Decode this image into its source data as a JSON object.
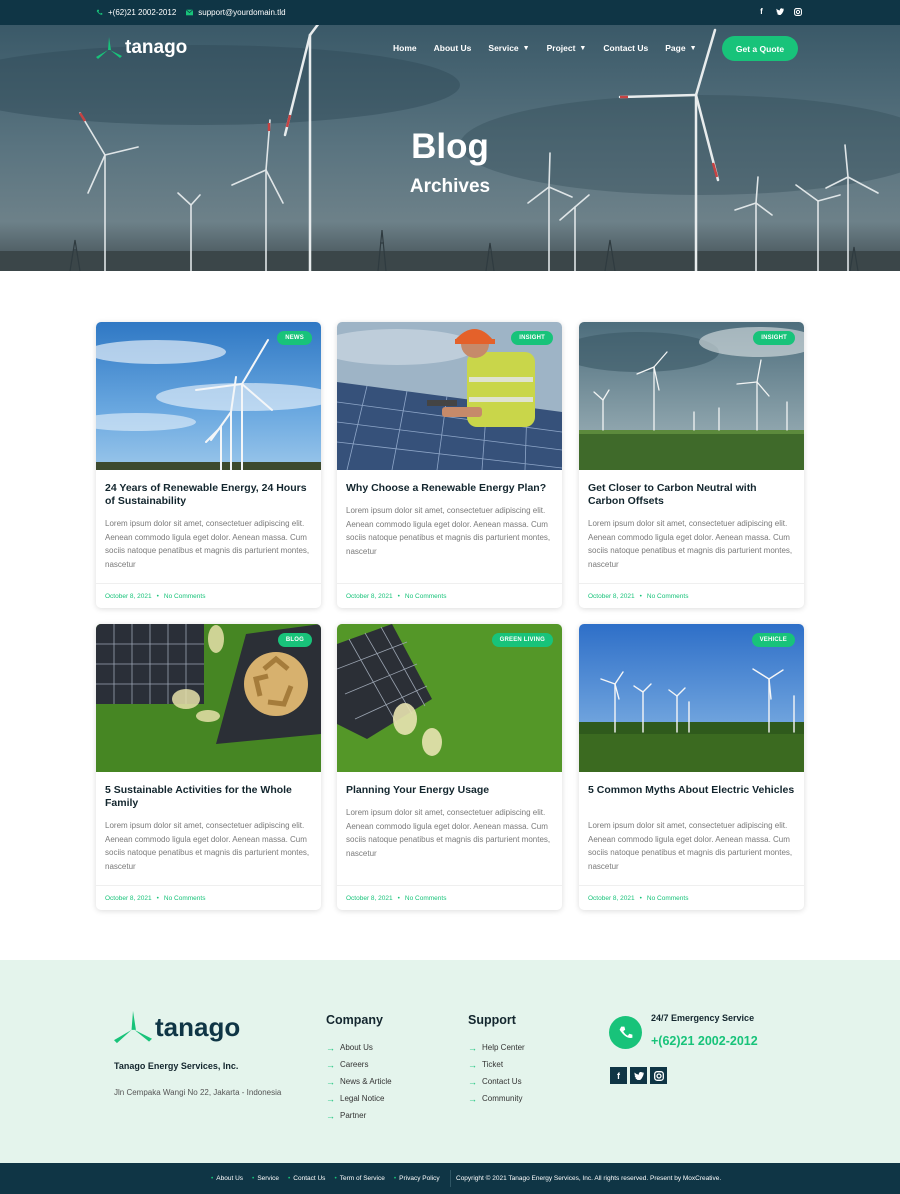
{
  "topbar": {
    "phone": "+(62)21 2002-2012",
    "email": "support@yourdomain.tld",
    "social": [
      "facebook-icon",
      "twitter-icon",
      "instagram-icon"
    ]
  },
  "nav": {
    "logo": "tanago",
    "menu": [
      {
        "label": "Home",
        "dropdown": false
      },
      {
        "label": "About Us",
        "dropdown": false
      },
      {
        "label": "Service",
        "dropdown": true
      },
      {
        "label": "Project",
        "dropdown": true
      },
      {
        "label": "Contact Us",
        "dropdown": false
      },
      {
        "label": "Page",
        "dropdown": true
      }
    ],
    "cta": "Get a Quote"
  },
  "hero": {
    "title": "Blog",
    "subtitle": "Archives"
  },
  "posts": [
    {
      "badge": "News",
      "title": "24 Years of Renewable Energy, 24 Hours of Sustainability",
      "excerpt": "Lorem ipsum dolor sit amet, consectetuer adipiscing elit. Aenean commodo ligula eget dolor. Aenean massa. Cum sociis natoque penatibus et magnis dis parturient montes, nascetur",
      "date": "October 8, 2021",
      "comments": "No Comments"
    },
    {
      "badge": "Insight",
      "title": "Why Choose a Renewable Energy Plan?",
      "excerpt": "Lorem ipsum dolor sit amet, consectetuer adipiscing elit. Aenean commodo ligula eget dolor. Aenean massa. Cum sociis natoque penatibus et magnis dis parturient montes, nascetur",
      "date": "October 8, 2021",
      "comments": "No Comments"
    },
    {
      "badge": "Insight",
      "title": "Get Closer to Carbon Neutral with Carbon Offsets",
      "excerpt": "Lorem ipsum dolor sit amet, consectetuer adipiscing elit. Aenean commodo ligula eget dolor. Aenean massa. Cum sociis natoque penatibus et magnis dis parturient montes, nascetur",
      "date": "October 8, 2021",
      "comments": "No Comments"
    },
    {
      "badge": "Blog",
      "title": "5 Sustainable Activities for the Whole Family",
      "excerpt": "Lorem ipsum dolor sit amet, consectetuer adipiscing elit. Aenean commodo ligula eget dolor. Aenean massa. Cum sociis natoque penatibus et magnis dis parturient montes, nascetur",
      "date": "October 8, 2021",
      "comments": "No Comments"
    },
    {
      "badge": "Green Living",
      "title": "Planning Your Energy Usage",
      "excerpt": "Lorem ipsum dolor sit amet, consectetuer adipiscing elit. Aenean commodo ligula eget dolor. Aenean massa. Cum sociis natoque penatibus et magnis dis parturient montes, nascetur",
      "date": "October 8, 2021",
      "comments": "No Comments"
    },
    {
      "badge": "Vehicle",
      "title": "5 Common Myths About Electric Vehicles",
      "excerpt": "Lorem ipsum dolor sit amet, consectetuer adipiscing elit. Aenean commodo ligula eget dolor. Aenean massa. Cum sociis natoque penatibus et magnis dis parturient montes, nascetur",
      "date": "October 8, 2021",
      "comments": "No Comments"
    }
  ],
  "footer": {
    "logo": "tanago",
    "company_name": "Tanago Energy Services, Inc.",
    "address": "Jln Cempaka Wangi No 22, Jakarta - Indonesia",
    "company_heading": "Company",
    "company_links": [
      "About Us",
      "Careers",
      "News & Article",
      "Legal Notice",
      "Partner"
    ],
    "support_heading": "Support",
    "support_links": [
      "Help Center",
      "Ticket",
      "Contact Us",
      "Community"
    ],
    "emergency_label": "24/7 Emergency Service",
    "emergency_phone": "+(62)21 2002-2012",
    "social": [
      "facebook-icon",
      "twitter-icon",
      "instagram-icon"
    ]
  },
  "bottombar": {
    "links": [
      "About Us",
      "Service",
      "Contact Us",
      "Term of Service",
      "Privacy Policy"
    ],
    "copyright": "Copyright © 2021 Tanago Energy Services, Inc. All rights reserved. Present by MoxCreative."
  },
  "colors": {
    "brand_green": "#18c37a",
    "dark_navy": "#0f3545",
    "footer_bg": "#e4f4ec"
  }
}
